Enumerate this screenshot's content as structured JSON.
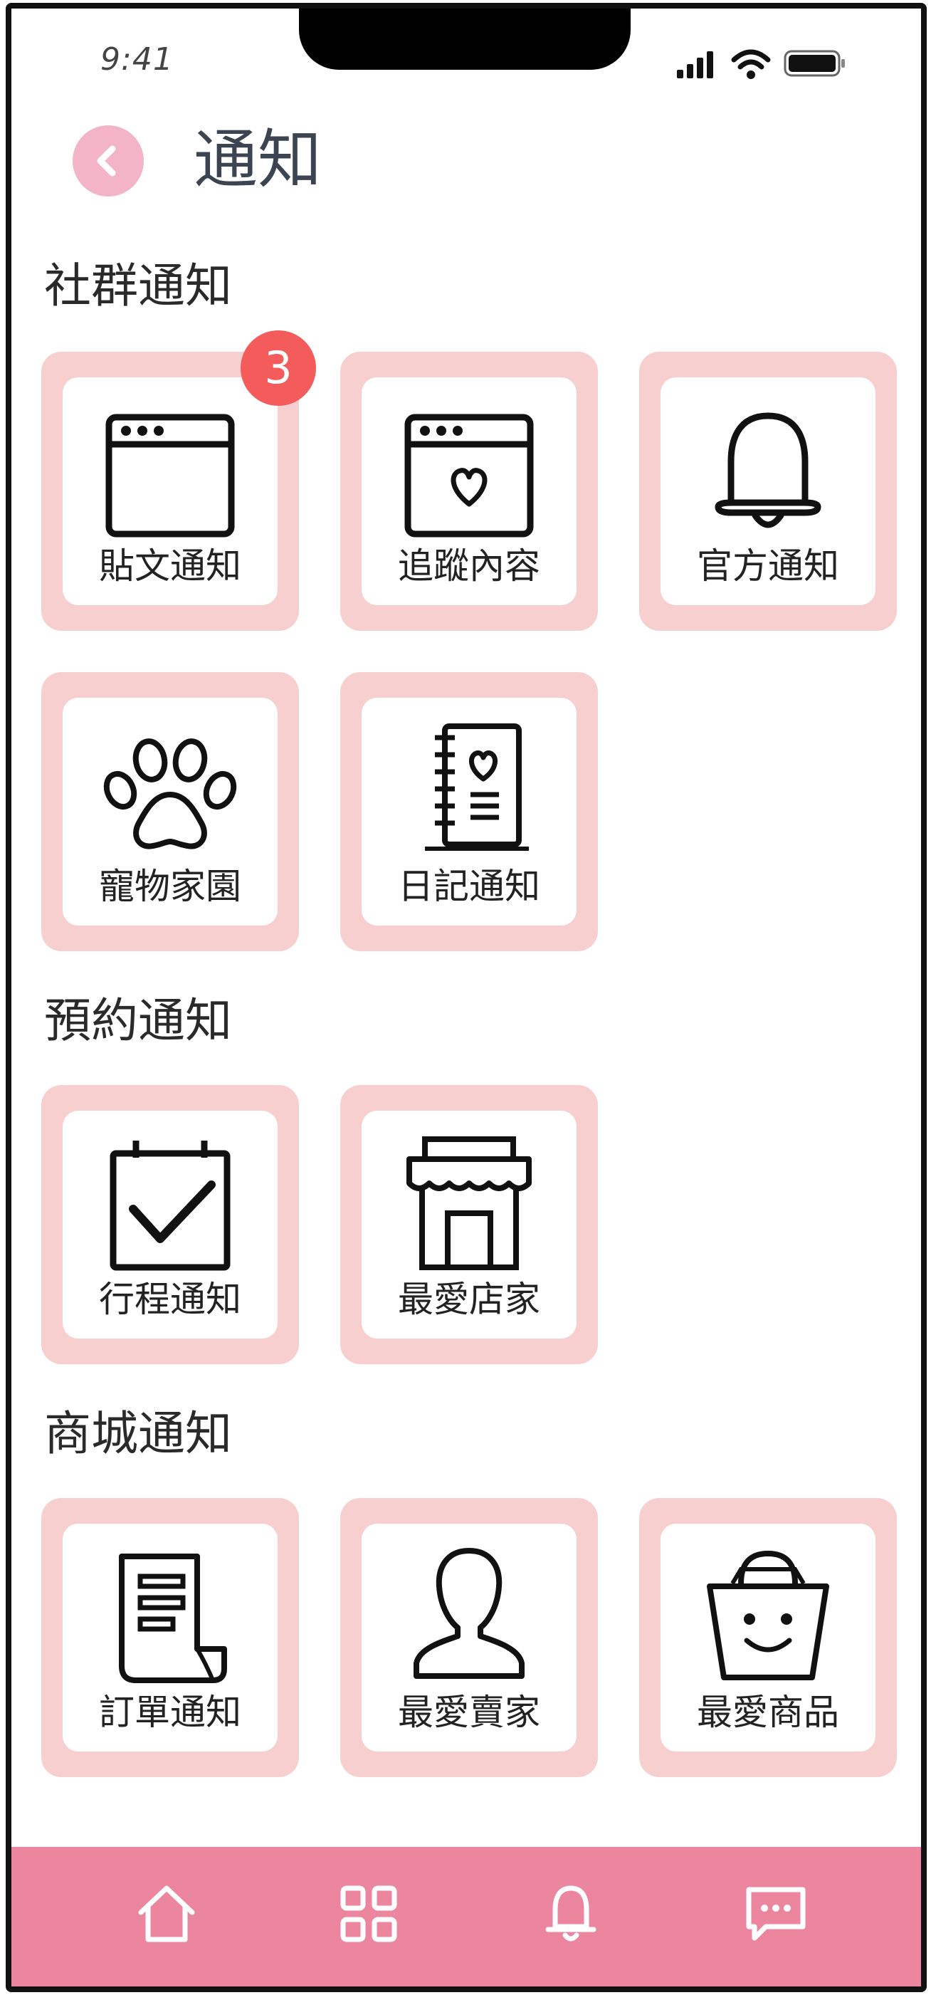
{
  "status_bar": {
    "time": "9:41"
  },
  "header": {
    "title": "通知"
  },
  "sections": [
    {
      "title": "社群通知",
      "tiles": [
        {
          "label": "貼文通知",
          "icon": "browser-window-icon",
          "badge": "3"
        },
        {
          "label": "追蹤內容",
          "icon": "browser-heart-icon"
        },
        {
          "label": "官方通知",
          "icon": "bell-icon"
        },
        {
          "label": "寵物家園",
          "icon": "paw-icon"
        },
        {
          "label": "日記通知",
          "icon": "diary-icon"
        }
      ]
    },
    {
      "title": "預約通知",
      "tiles": [
        {
          "label": "行程通知",
          "icon": "calendar-check-icon"
        },
        {
          "label": "最愛店家",
          "icon": "store-icon"
        }
      ]
    },
    {
      "title": "商城通知",
      "tiles": [
        {
          "label": "訂單通知",
          "icon": "receipt-icon"
        },
        {
          "label": "最愛賣家",
          "icon": "user-icon"
        },
        {
          "label": "最愛商品",
          "icon": "shopping-bag-icon"
        }
      ]
    }
  ],
  "bottom_nav": [
    "home-icon",
    "grid-icon",
    "bell-icon",
    "chat-icon"
  ],
  "colors": {
    "tile_bg": "#f8cfcf",
    "nav_bg": "#ec869f",
    "back_button": "#f3b4c7",
    "badge": "#f45b5b"
  }
}
